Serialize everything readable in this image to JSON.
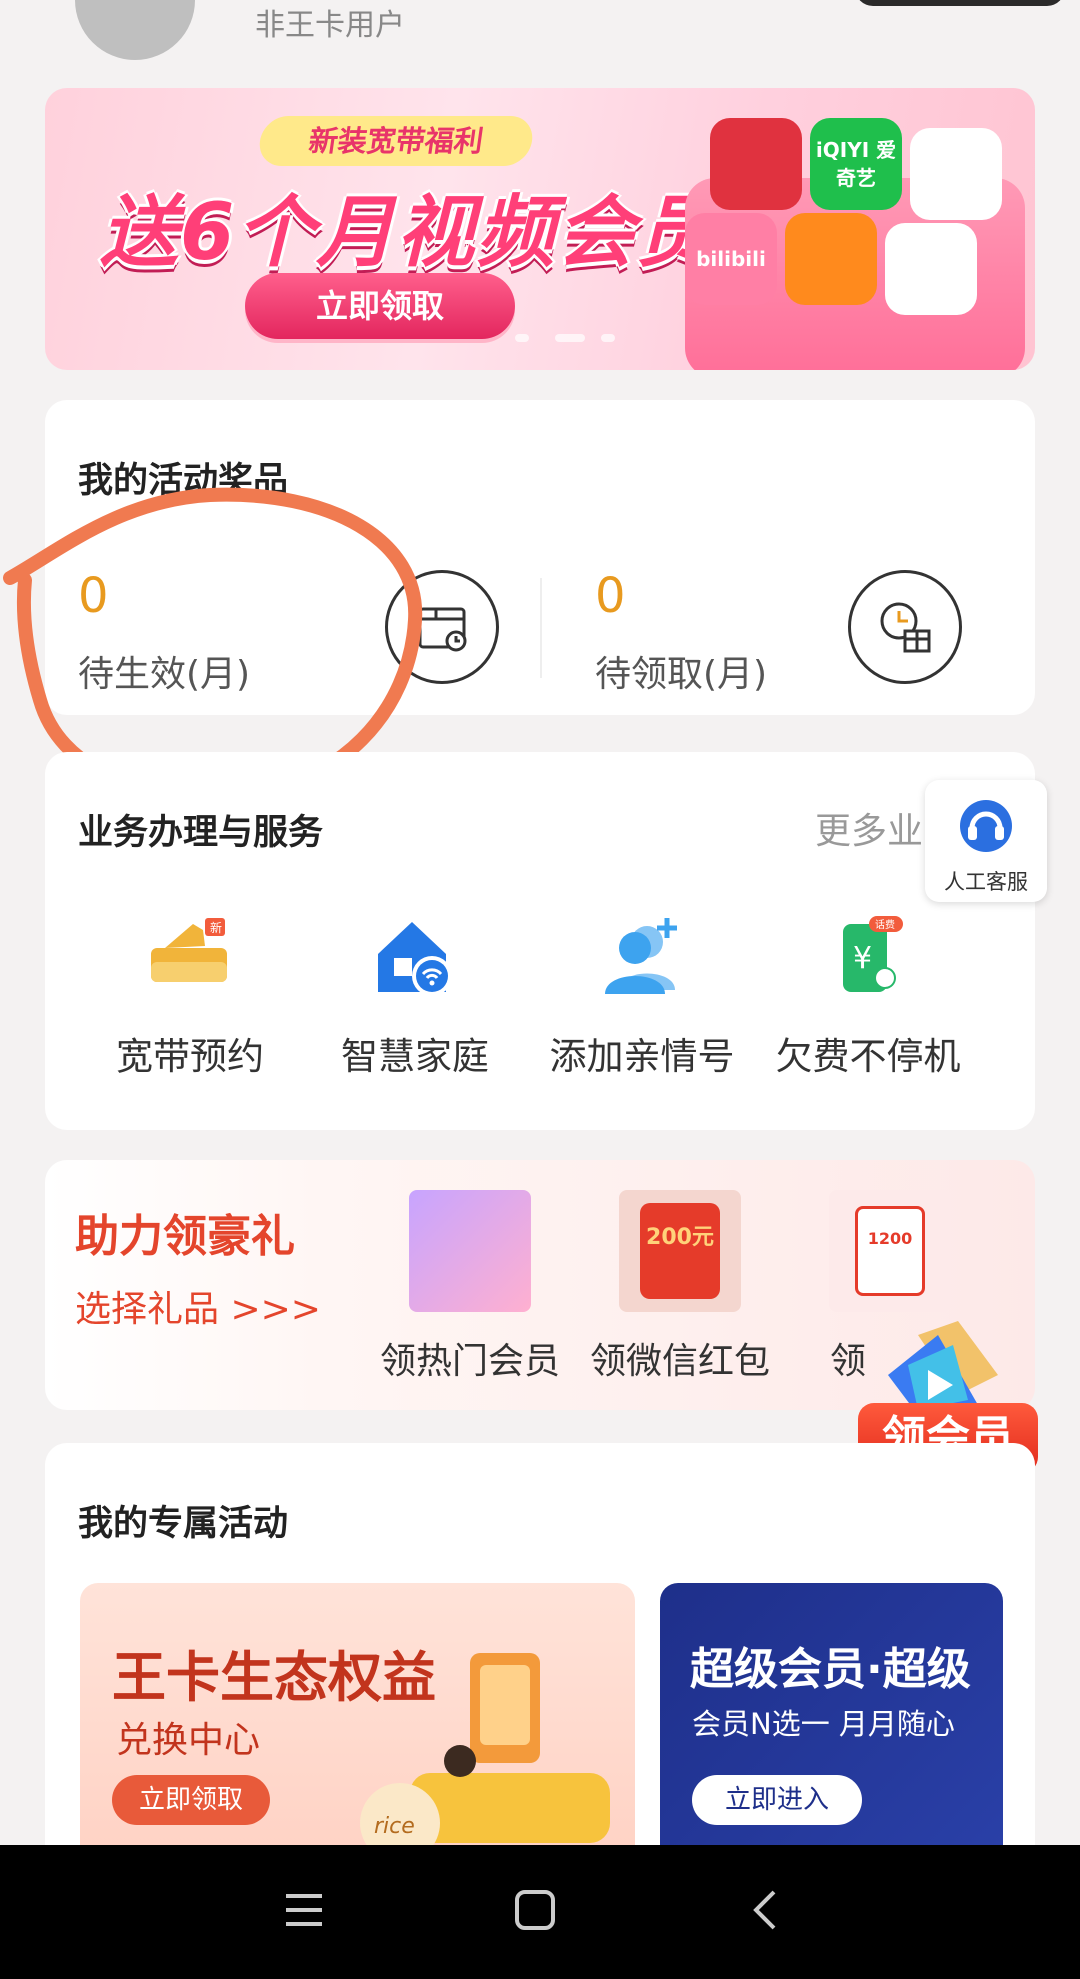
{
  "header": {
    "user_type": "非王卡用户"
  },
  "banner": {
    "tag": "新装宽带福利",
    "headline": "送6个月视频会员",
    "cta": "立即领取",
    "app_tiles": [
      "",
      "iQIYI 爱奇艺",
      "",
      "bilibili",
      "",
      ""
    ]
  },
  "prizes": {
    "title": "我的活动奖品",
    "items": [
      {
        "count": "0",
        "label": "待生效(月)",
        "icon": "gift-box-clock-icon"
      },
      {
        "count": "0",
        "label": "待领取(月)",
        "icon": "gift-clock-icon"
      }
    ]
  },
  "services": {
    "title": "业务办理与服务",
    "more": "更多业",
    "items": [
      {
        "label": "宽带预约",
        "icon": "broadband-router-icon"
      },
      {
        "label": "智慧家庭",
        "icon": "smart-home-icon"
      },
      {
        "label": "添加亲情号",
        "icon": "add-family-icon"
      },
      {
        "label": "欠费不停机",
        "icon": "arrears-phone-icon"
      }
    ],
    "new_badge": "新",
    "phone_badge": "话费"
  },
  "customer_service": {
    "label": "人工客服"
  },
  "gift_promo": {
    "title": "助力领豪礼",
    "subtitle": "选择礼品 >>>",
    "items": [
      {
        "label": "领热门会员"
      },
      {
        "label": "领微信红包",
        "thumb_text": "200元"
      },
      {
        "label": "领",
        "thumb_text": "1200"
      }
    ],
    "vip_badge": "领会员"
  },
  "exclusive": {
    "title": "我的专属活动",
    "cards": [
      {
        "title": "王卡生态权益",
        "subtitle": "兑换中心",
        "button": "立即领取",
        "product_text": "rice"
      },
      {
        "title": "超级会员·超级",
        "subtitle": "会员N选一 月月随心",
        "button": "立即进入"
      }
    ]
  },
  "colors": {
    "accent_orange": "#e89a1f",
    "promo_red": "#e4452c",
    "banner_pink": "#ff3f78",
    "annotation": "#f07a50"
  }
}
